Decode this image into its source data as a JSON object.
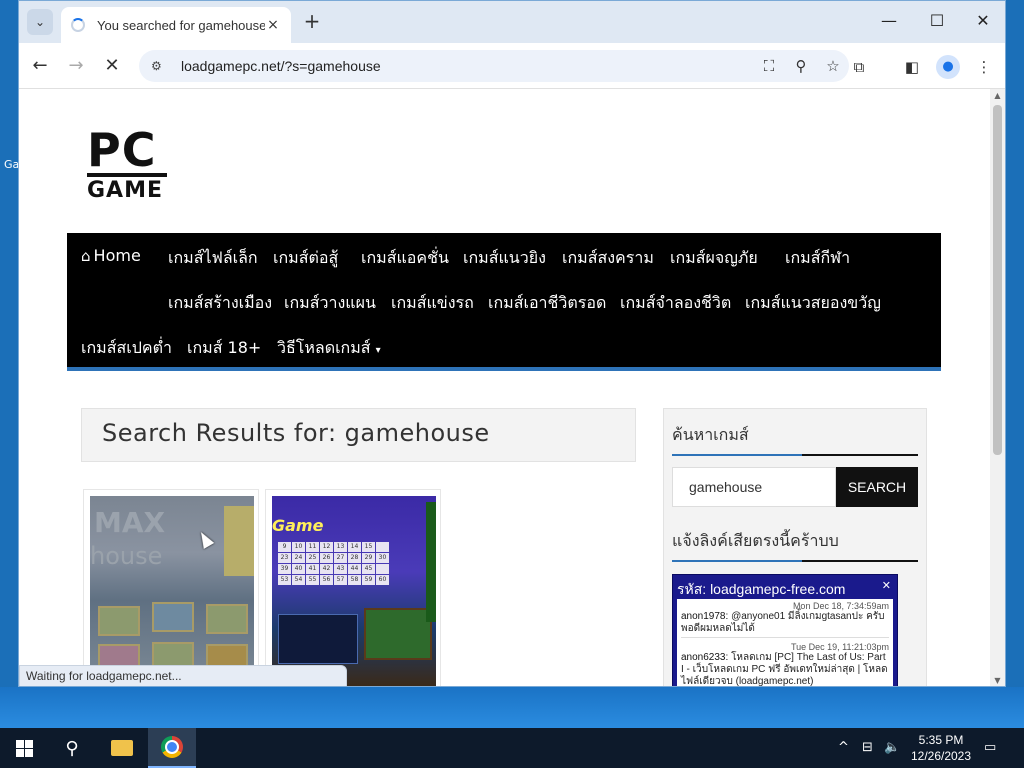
{
  "desktop": {
    "label": "Ga"
  },
  "browser": {
    "tab": {
      "title": "You searched for gamehouse -",
      "close_icon": "×"
    },
    "new_tab_icon": "+",
    "window_controls": {
      "minimize": "—",
      "maximize": "☐",
      "close": "✕"
    },
    "url": "loadgamepc.net/?s=gamehouse",
    "status_text": "Waiting for loadgamepc.net..."
  },
  "page": {
    "logo": {
      "line1": "PC",
      "line2": "GAME"
    },
    "nav": {
      "home": "Home",
      "row1": [
        "เกมส์ไฟล์เล็ก",
        "เกมส์ต่อสู้",
        "เกมส์แอคชั่น",
        "เกมส์แนวยิง",
        "เกมส์สงคราม",
        "เกมส์ผจญภัย",
        "เกมส์กีฬา"
      ],
      "row2": [
        "เกมส์สร้างเมือง",
        "เกมส์วางแผน",
        "เกมส์แข่งรถ",
        "เกมส์เอาชีวิตรอด",
        "เกมส์จำลองชีวิต",
        "เกมส์แนวสยองขวัญ"
      ],
      "row3": [
        "เกมส์สเปคต่ำ",
        "เกมส์ 18+",
        "วิธีโหลดเกมส์"
      ]
    },
    "results_title": "Search Results for: gamehouse",
    "thumbs": {
      "t1_line1": "MAX",
      "t1_line2": "house",
      "t2_title": "Game",
      "t2_numbers": [
        "9",
        "10",
        "11",
        "12",
        "13",
        "14",
        "15",
        "",
        "23",
        "24",
        "25",
        "26",
        "27",
        "28",
        "29",
        "30",
        "39",
        "40",
        "41",
        "42",
        "43",
        "44",
        "45",
        "",
        "53",
        "54",
        "55",
        "56",
        "57",
        "58",
        "59",
        "60"
      ]
    },
    "sidebar": {
      "search_heading": "ค้นหาเกมส์",
      "search_value": "gamehouse",
      "search_button": "SEARCH",
      "report_heading": "แจ้งลิงค์เสียตรงนี้คร้าบบ",
      "chat": {
        "title": "รหัส: loadgamepc-free.com",
        "messages": [
          {
            "time": "Mon Dec 18, 7:34:59am",
            "user": "anon1978:",
            "text": "@anyone01 มีลิ้งเกมgtasanปะ ครับพอดีผมหลดไม่ได้"
          },
          {
            "time": "Tue Dec 19, 11:21:03pm",
            "user": "anon6233:",
            "text": "โหลดเกม [PC] The Last of Us: Part I - เว็บโหลดเกม PC ฟรี อัพเดทใหม่ล่าสุด | โหลดไฟล์เดียวจบ (loadgamepc.net)"
          }
        ]
      }
    }
  },
  "taskbar": {
    "time": "5:35 PM",
    "date": "12/26/2023"
  }
}
